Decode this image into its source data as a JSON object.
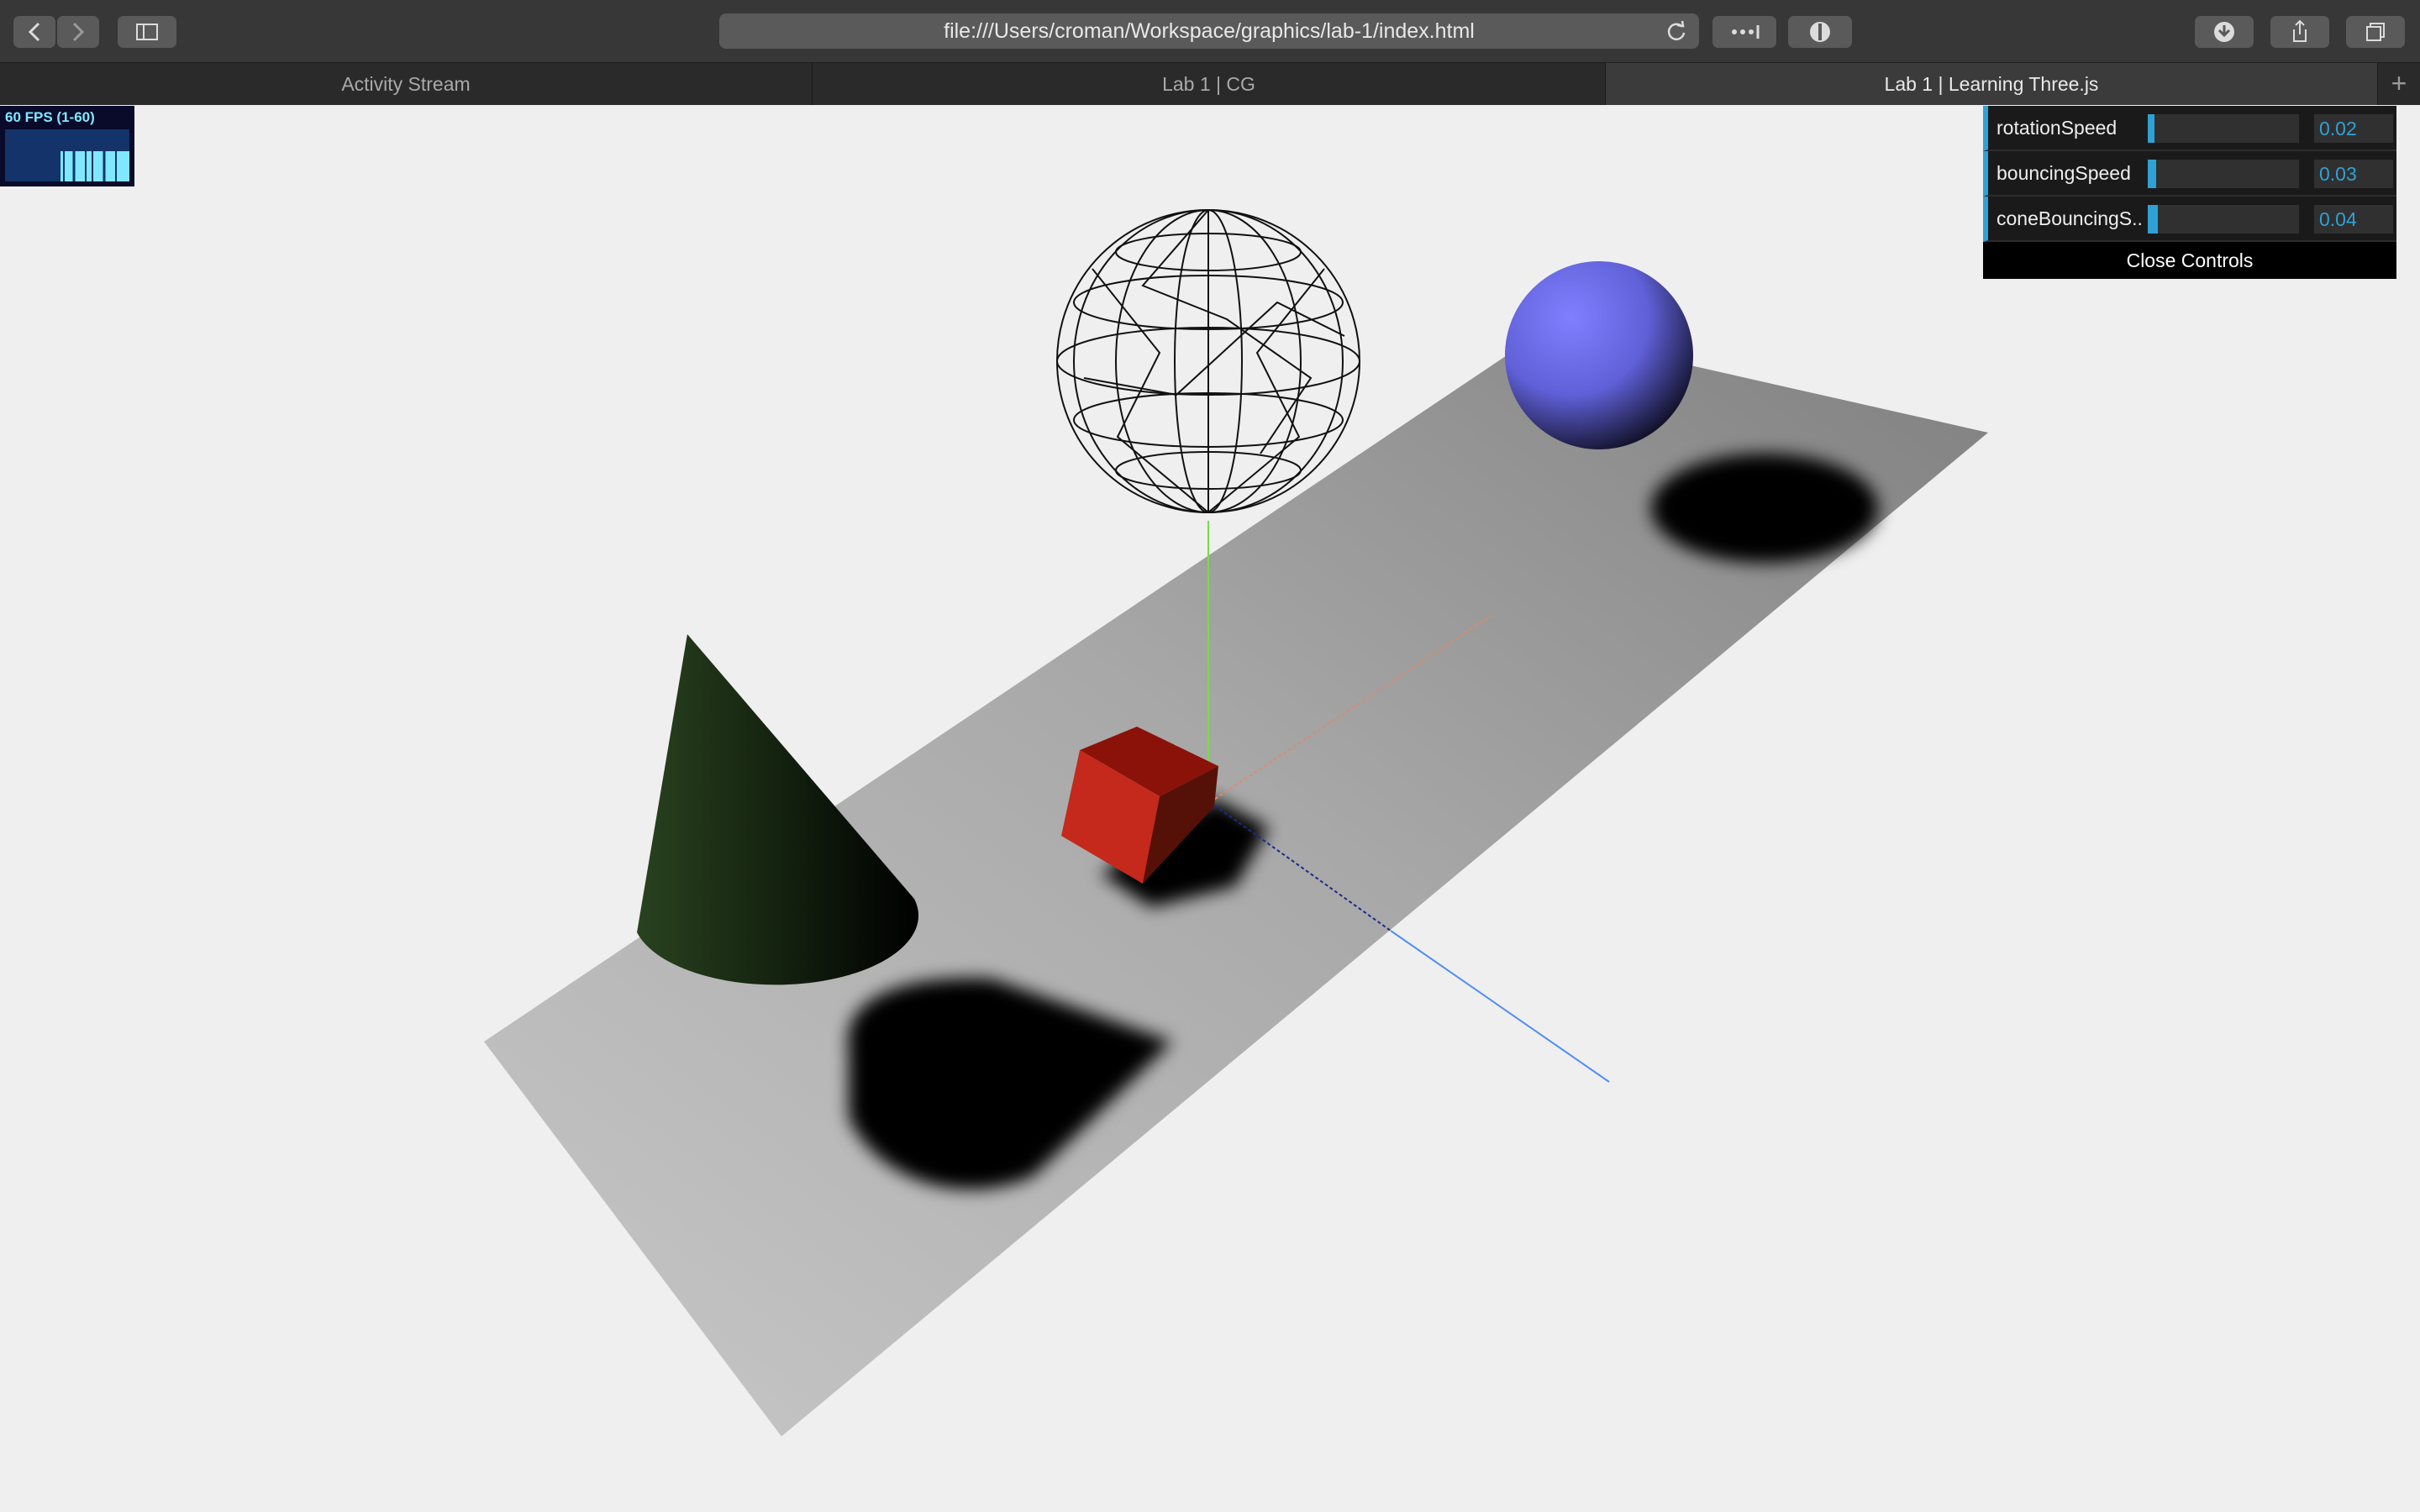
{
  "browser": {
    "url": "file:///Users/croman/Workspace/graphics/lab-1/index.html",
    "tabs": [
      {
        "label": "Activity Stream",
        "active": false
      },
      {
        "label": "Lab 1 | CG",
        "active": false
      },
      {
        "label": "Lab 1 | Learning Three.js",
        "active": true
      }
    ],
    "icons": [
      "back-arrow-icon",
      "forward-arrow-icon",
      "sidebar-icon",
      "reload-icon",
      "more-icon",
      "privacy-shield-icon",
      "download-icon",
      "share-icon",
      "tabs-icon",
      "plus-icon"
    ]
  },
  "stats": {
    "label": "60 FPS (1-60)"
  },
  "gui": {
    "controls": [
      {
        "label": "rotationSpeed",
        "value": "0.02",
        "fill": 0.02
      },
      {
        "label": "bouncingSpeed",
        "value": "0.03",
        "fill": 0.03
      },
      {
        "label": "coneBouncingS..",
        "value": "0.04",
        "fill": 0.04
      }
    ],
    "close_label": "Close Controls"
  },
  "colors": {
    "gui_accent": "#2fa1d6",
    "sphere": "#7b7bff",
    "cube": "#b81d12",
    "cone": "#233a1c",
    "fps_text": "#7fe8ff"
  }
}
